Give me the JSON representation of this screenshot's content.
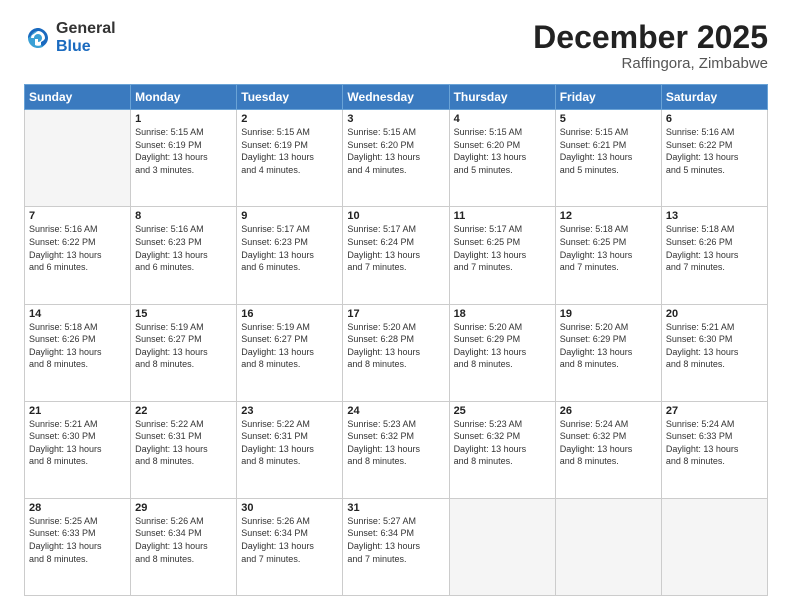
{
  "logo": {
    "general": "General",
    "blue": "Blue"
  },
  "title": "December 2025",
  "location": "Raffingora, Zimbabwe",
  "days_of_week": [
    "Sunday",
    "Monday",
    "Tuesday",
    "Wednesday",
    "Thursday",
    "Friday",
    "Saturday"
  ],
  "weeks": [
    [
      {
        "day": "",
        "info": ""
      },
      {
        "day": "1",
        "info": "Sunrise: 5:15 AM\nSunset: 6:19 PM\nDaylight: 13 hours\nand 3 minutes."
      },
      {
        "day": "2",
        "info": "Sunrise: 5:15 AM\nSunset: 6:19 PM\nDaylight: 13 hours\nand 4 minutes."
      },
      {
        "day": "3",
        "info": "Sunrise: 5:15 AM\nSunset: 6:20 PM\nDaylight: 13 hours\nand 4 minutes."
      },
      {
        "day": "4",
        "info": "Sunrise: 5:15 AM\nSunset: 6:20 PM\nDaylight: 13 hours\nand 5 minutes."
      },
      {
        "day": "5",
        "info": "Sunrise: 5:15 AM\nSunset: 6:21 PM\nDaylight: 13 hours\nand 5 minutes."
      },
      {
        "day": "6",
        "info": "Sunrise: 5:16 AM\nSunset: 6:22 PM\nDaylight: 13 hours\nand 5 minutes."
      }
    ],
    [
      {
        "day": "7",
        "info": "Sunrise: 5:16 AM\nSunset: 6:22 PM\nDaylight: 13 hours\nand 6 minutes."
      },
      {
        "day": "8",
        "info": "Sunrise: 5:16 AM\nSunset: 6:23 PM\nDaylight: 13 hours\nand 6 minutes."
      },
      {
        "day": "9",
        "info": "Sunrise: 5:17 AM\nSunset: 6:23 PM\nDaylight: 13 hours\nand 6 minutes."
      },
      {
        "day": "10",
        "info": "Sunrise: 5:17 AM\nSunset: 6:24 PM\nDaylight: 13 hours\nand 7 minutes."
      },
      {
        "day": "11",
        "info": "Sunrise: 5:17 AM\nSunset: 6:25 PM\nDaylight: 13 hours\nand 7 minutes."
      },
      {
        "day": "12",
        "info": "Sunrise: 5:18 AM\nSunset: 6:25 PM\nDaylight: 13 hours\nand 7 minutes."
      },
      {
        "day": "13",
        "info": "Sunrise: 5:18 AM\nSunset: 6:26 PM\nDaylight: 13 hours\nand 7 minutes."
      }
    ],
    [
      {
        "day": "14",
        "info": "Sunrise: 5:18 AM\nSunset: 6:26 PM\nDaylight: 13 hours\nand 8 minutes."
      },
      {
        "day": "15",
        "info": "Sunrise: 5:19 AM\nSunset: 6:27 PM\nDaylight: 13 hours\nand 8 minutes."
      },
      {
        "day": "16",
        "info": "Sunrise: 5:19 AM\nSunset: 6:27 PM\nDaylight: 13 hours\nand 8 minutes."
      },
      {
        "day": "17",
        "info": "Sunrise: 5:20 AM\nSunset: 6:28 PM\nDaylight: 13 hours\nand 8 minutes."
      },
      {
        "day": "18",
        "info": "Sunrise: 5:20 AM\nSunset: 6:29 PM\nDaylight: 13 hours\nand 8 minutes."
      },
      {
        "day": "19",
        "info": "Sunrise: 5:20 AM\nSunset: 6:29 PM\nDaylight: 13 hours\nand 8 minutes."
      },
      {
        "day": "20",
        "info": "Sunrise: 5:21 AM\nSunset: 6:30 PM\nDaylight: 13 hours\nand 8 minutes."
      }
    ],
    [
      {
        "day": "21",
        "info": "Sunrise: 5:21 AM\nSunset: 6:30 PM\nDaylight: 13 hours\nand 8 minutes."
      },
      {
        "day": "22",
        "info": "Sunrise: 5:22 AM\nSunset: 6:31 PM\nDaylight: 13 hours\nand 8 minutes."
      },
      {
        "day": "23",
        "info": "Sunrise: 5:22 AM\nSunset: 6:31 PM\nDaylight: 13 hours\nand 8 minutes."
      },
      {
        "day": "24",
        "info": "Sunrise: 5:23 AM\nSunset: 6:32 PM\nDaylight: 13 hours\nand 8 minutes."
      },
      {
        "day": "25",
        "info": "Sunrise: 5:23 AM\nSunset: 6:32 PM\nDaylight: 13 hours\nand 8 minutes."
      },
      {
        "day": "26",
        "info": "Sunrise: 5:24 AM\nSunset: 6:32 PM\nDaylight: 13 hours\nand 8 minutes."
      },
      {
        "day": "27",
        "info": "Sunrise: 5:24 AM\nSunset: 6:33 PM\nDaylight: 13 hours\nand 8 minutes."
      }
    ],
    [
      {
        "day": "28",
        "info": "Sunrise: 5:25 AM\nSunset: 6:33 PM\nDaylight: 13 hours\nand 8 minutes."
      },
      {
        "day": "29",
        "info": "Sunrise: 5:26 AM\nSunset: 6:34 PM\nDaylight: 13 hours\nand 8 minutes."
      },
      {
        "day": "30",
        "info": "Sunrise: 5:26 AM\nSunset: 6:34 PM\nDaylight: 13 hours\nand 7 minutes."
      },
      {
        "day": "31",
        "info": "Sunrise: 5:27 AM\nSunset: 6:34 PM\nDaylight: 13 hours\nand 7 minutes."
      },
      {
        "day": "",
        "info": ""
      },
      {
        "day": "",
        "info": ""
      },
      {
        "day": "",
        "info": ""
      }
    ]
  ]
}
